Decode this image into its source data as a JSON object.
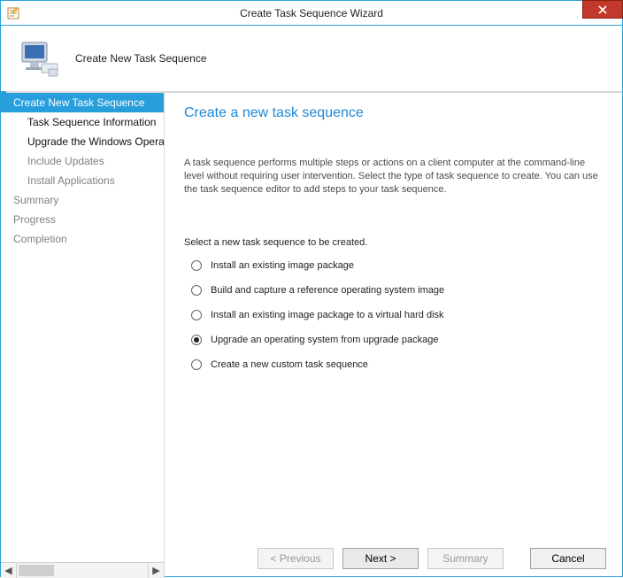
{
  "window": {
    "title": "Create Task Sequence Wizard"
  },
  "header": {
    "subtitle": "Create New Task Sequence"
  },
  "nav": {
    "items": [
      {
        "label": "Create New Task Sequence",
        "level": "top",
        "state": "selected"
      },
      {
        "label": "Task Sequence Information",
        "level": "sub",
        "state": "bold"
      },
      {
        "label": "Upgrade the Windows Operating System",
        "level": "sub",
        "state": "bold"
      },
      {
        "label": "Include Updates",
        "level": "sub",
        "state": "dim"
      },
      {
        "label": "Install Applications",
        "level": "sub",
        "state": "dim"
      },
      {
        "label": "Summary",
        "level": "top",
        "state": "dim"
      },
      {
        "label": "Progress",
        "level": "top",
        "state": "dim"
      },
      {
        "label": "Completion",
        "level": "top",
        "state": "dim"
      }
    ]
  },
  "content": {
    "title": "Create a new task sequence",
    "description": "A task sequence performs multiple steps or actions on a client computer at the command-line level without requiring user intervention. Select the type of task sequence to create. You can use the task sequence editor to add steps to your task sequence.",
    "select_label": "Select a new task sequence to be created.",
    "options": [
      {
        "label": "Install an existing image package",
        "checked": false
      },
      {
        "label": "Build and capture a reference operating system image",
        "checked": false
      },
      {
        "label": "Install an existing image package to a virtual hard disk",
        "checked": false
      },
      {
        "label": "Upgrade an operating system from upgrade package",
        "checked": true
      },
      {
        "label": "Create a new custom task sequence",
        "checked": false
      }
    ]
  },
  "footer": {
    "previous": "< Previous",
    "next": "Next >",
    "summary": "Summary",
    "cancel": "Cancel"
  }
}
